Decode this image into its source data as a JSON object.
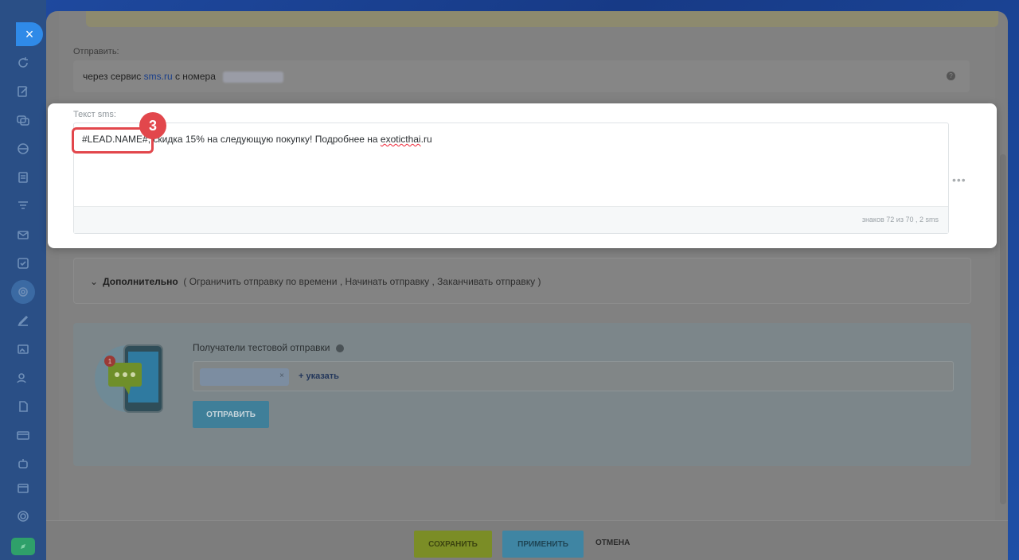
{
  "sidebar": {
    "close_icon": "×"
  },
  "send_section": {
    "label": "Отправить:",
    "prefix": "через сервис",
    "service_link": "sms.ru",
    "suffix": "с номера"
  },
  "sms": {
    "label": "Текст sms:",
    "placeholder_token": "#LEAD.NAME#",
    "text_rest": ", скидка 15% на следующую покупку! Подробнее на ",
    "link_word": "exoticthai",
    "link_tail": ".ru",
    "counter_prefix": "знаков",
    "counter_value": "72 из 70",
    "counter_suffix": ", 2 sms",
    "more_menu": "•••"
  },
  "step_badge": "3",
  "extra": {
    "title": "Дополнительно",
    "options": "( Ограничить отправку по времени ,  Начинать отправку ,  Заканчивать отправку )"
  },
  "test_send": {
    "label": "Получатели тестовой отправки",
    "chip_remove": "×",
    "add_link": "+ указать",
    "send_button": "ОТПРАВИТЬ",
    "illustration_badge": "1"
  },
  "footer": {
    "save": "СОХРАНИТЬ",
    "apply": "ПРИМЕНИТЬ",
    "cancel": "ОТМЕНА"
  }
}
